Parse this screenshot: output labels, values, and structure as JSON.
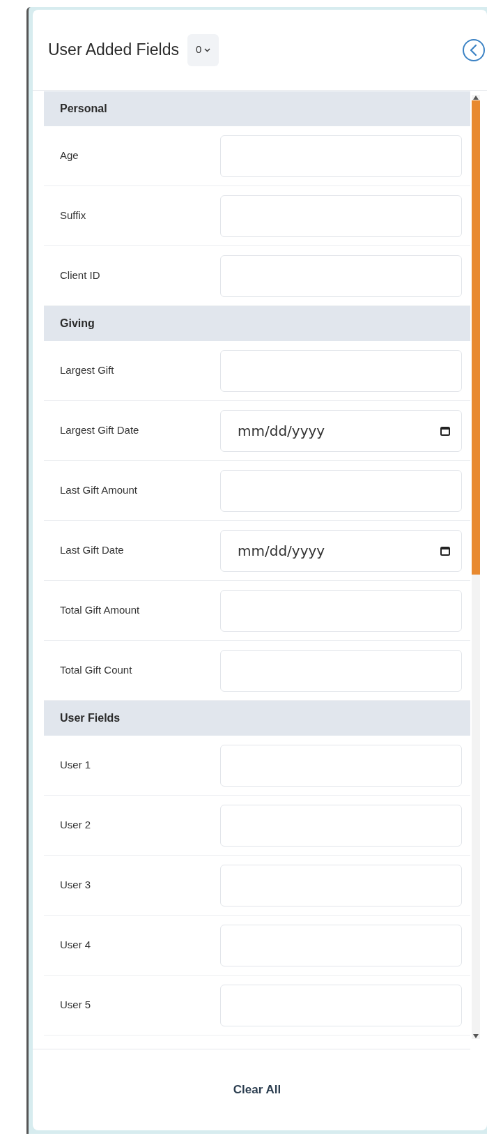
{
  "header": {
    "title": "User Added Fields",
    "count": "0"
  },
  "sections": [
    {
      "title": "Personal",
      "fields": [
        {
          "label": "Age",
          "kind": "text"
        },
        {
          "label": "Suffix",
          "kind": "text"
        },
        {
          "label": "Client ID",
          "kind": "text"
        }
      ]
    },
    {
      "title": "Giving",
      "fields": [
        {
          "label": "Largest Gift",
          "kind": "text"
        },
        {
          "label": "Largest Gift Date",
          "kind": "date",
          "placeholder": "mm/dd/yyyy"
        },
        {
          "label": "Last Gift Amount",
          "kind": "text"
        },
        {
          "label": "Last Gift Date",
          "kind": "date",
          "placeholder": "mm/dd/yyyy"
        },
        {
          "label": "Total Gift Amount",
          "kind": "text"
        },
        {
          "label": "Total Gift Count",
          "kind": "text"
        }
      ]
    },
    {
      "title": "User Fields",
      "fields": [
        {
          "label": "User 1",
          "kind": "text"
        },
        {
          "label": "User 2",
          "kind": "text"
        },
        {
          "label": "User 3",
          "kind": "text"
        },
        {
          "label": "User 4",
          "kind": "text"
        },
        {
          "label": "User 5",
          "kind": "text"
        }
      ]
    }
  ],
  "footer": {
    "button": "Clear All"
  }
}
